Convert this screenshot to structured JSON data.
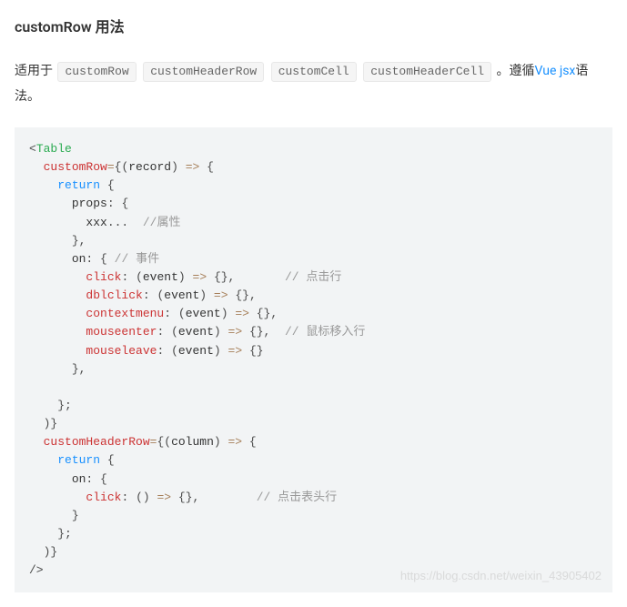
{
  "title": "customRow 用法",
  "intro": {
    "prefix": "适用于",
    "tags": [
      "customRow",
      "customHeaderRow",
      "customCell",
      "customHeaderCell"
    ],
    "after_tags": "。遵循",
    "link_text": "Vue jsx",
    "after_link": "语法。"
  },
  "code": {
    "l1_table": "Table",
    "l2_customRow": "customRow",
    "l2_record": "record",
    "l2_arrow": "=>",
    "l3_return": "return",
    "l4_props": "props",
    "l5_xxx": "xxx",
    "l5_dots": "...",
    "l5_comment": "//属性",
    "l7_on": "on",
    "l7_comment": "// 事件",
    "l8_click": "click",
    "l8_event": "event",
    "l8_arrow": "=>",
    "l8_comment": "// 点击行",
    "l9_dblclick": "dblclick",
    "l9_event": "event",
    "l9_arrow": "=>",
    "l10_contextmenu": "contextmenu",
    "l10_event": "event",
    "l10_arrow": "=>",
    "l11_mouseenter": "mouseenter",
    "l11_event": "event",
    "l11_arrow": "=>",
    "l11_comment": "// 鼠标移入行",
    "l12_mouseleave": "mouseleave",
    "l12_event": "event",
    "l12_arrow": "=>",
    "l17_customHeaderRow": "customHeaderRow",
    "l17_column": "column",
    "l17_arrow": "=>",
    "l18_return": "return",
    "l19_on": "on",
    "l20_click": "click",
    "l20_arrow": "=>",
    "l20_comment": "// 点击表头行"
  },
  "watermark": "https://blog.csdn.net/weixin_43905402"
}
